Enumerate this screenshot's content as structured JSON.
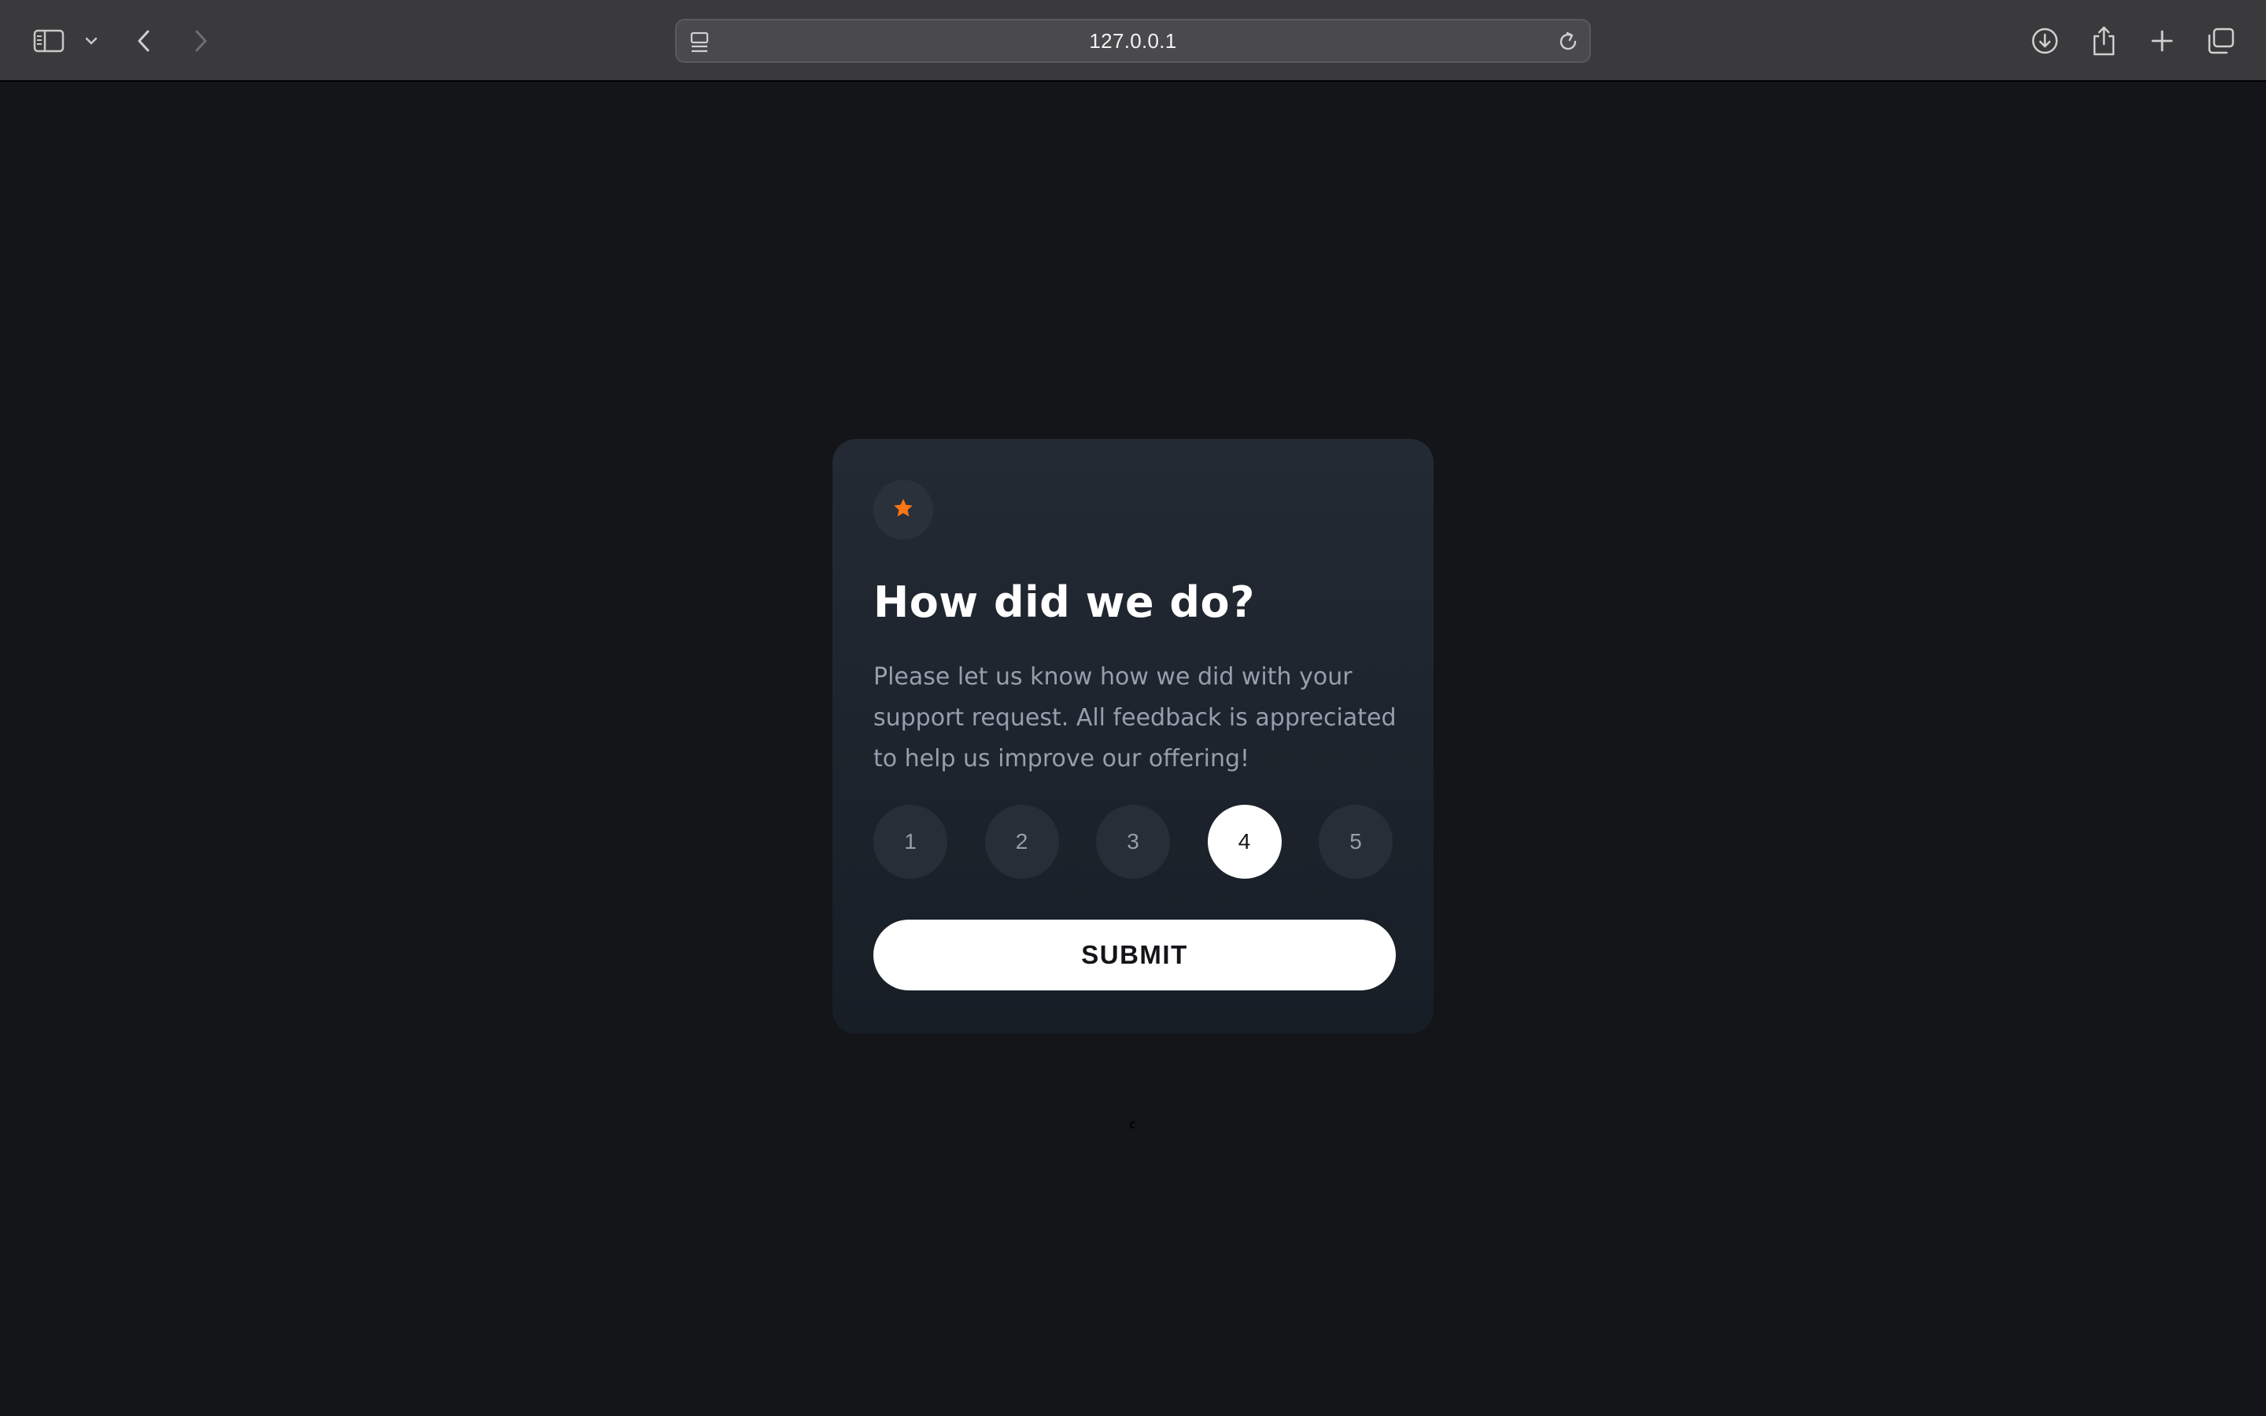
{
  "browser": {
    "url": "127.0.0.1",
    "icons": {
      "sidebar": "sidebar-icon",
      "sidebar_menu": "chevron-down-icon",
      "back": "chevron-left-icon",
      "forward": "chevron-right-icon",
      "page_menu": "page-menu-icon",
      "reload": "reload-icon",
      "download": "download-icon",
      "share": "share-icon",
      "new_tab": "plus-icon",
      "tabs": "tab-overview-icon"
    }
  },
  "card": {
    "icon": "star-icon",
    "title": "How did we do?",
    "description": "Please let us know how we did with your support request. All feedback is appreciated to help us improve our offering!",
    "ratings": [
      "1",
      "2",
      "3",
      "4",
      "5"
    ],
    "selected_rating": "4",
    "submit_label": "SUBMIT"
  },
  "colors": {
    "page_background": "#131518",
    "card_gradient_top": "#232a34",
    "card_gradient_bottom": "#181e26",
    "accent_orange": "#fc7614",
    "muted_text": "#969fad",
    "white": "#ffffff"
  }
}
